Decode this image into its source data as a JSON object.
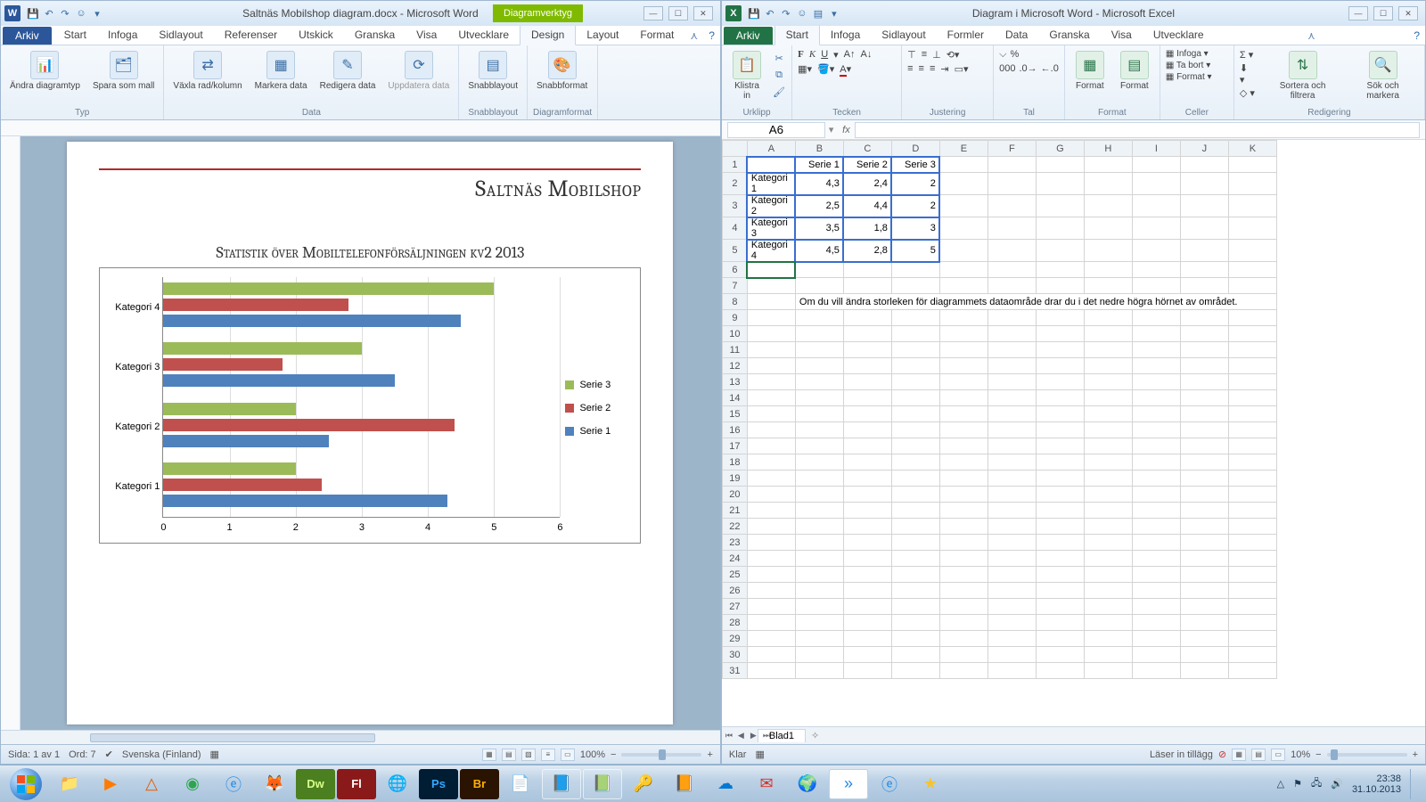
{
  "word": {
    "titlebar": "Saltnäs Mobilshop diagram.docx - Microsoft Word",
    "context_tab": "Diagramverktyg",
    "tabs": {
      "file": "Arkiv",
      "start": "Start",
      "infoga": "Infoga",
      "sidlayout": "Sidlayout",
      "referenser": "Referenser",
      "utskick": "Utskick",
      "granska": "Granska",
      "visa": "Visa",
      "utvecklare": "Utvecklare",
      "design": "Design",
      "layout": "Layout",
      "format": "Format"
    },
    "groups": {
      "typ": {
        "label": "Typ",
        "btn1": "Ändra\ndiagramtyp",
        "btn2": "Spara\nsom mall"
      },
      "data": {
        "label": "Data",
        "btn1": "Växla\nrad/kolumn",
        "btn2": "Markera\ndata",
        "btn3": "Redigera\ndata",
        "btn4": "Uppdatera\ndata"
      },
      "snabb": {
        "label": "Snabblayout",
        "btn1": "Snabblayout"
      },
      "format": {
        "label": "Diagramformat",
        "btn1": "Snabbformat"
      }
    },
    "doc": {
      "title": "Saltnäs Mobilshop",
      "chart_title": "Statistik över Mobiltelefonförsäljningen kv2 2013"
    },
    "status": {
      "page": "Sida: 1 av 1",
      "words": "Ord: 7",
      "lang": "Svenska (Finland)",
      "zoom": "100%"
    }
  },
  "excel": {
    "titlebar": "Diagram i Microsoft Word - Microsoft Excel",
    "tabs": {
      "file": "Arkiv",
      "start": "Start",
      "infoga": "Infoga",
      "sidlayout": "Sidlayout",
      "formler": "Formler",
      "data": "Data",
      "granska": "Granska",
      "visa": "Visa",
      "utvecklare": "Utvecklare"
    },
    "groups": {
      "urklipp": {
        "label": "Urklipp",
        "btn": "Klistra\nin"
      },
      "tecken": {
        "label": "Tecken"
      },
      "justering": {
        "label": "Justering"
      },
      "tal": {
        "label": "Tal"
      },
      "format": {
        "label": "Format",
        "btn1": "Format",
        "btn2": "Format"
      },
      "celler": {
        "label": "Celler",
        "insert": "Infoga",
        "delete": "Ta bort",
        "fmt": "Format"
      },
      "redigering": {
        "label": "Redigering",
        "sort": "Sortera och\nfiltrera",
        "find": "Sök och\nmarkera"
      }
    },
    "namebox": "A6",
    "headers": {
      "s1": "Serie 1",
      "s2": "Serie 2",
      "s3": "Serie 3"
    },
    "rows": {
      "k1": {
        "label": "Kategori 1",
        "v1": "4,3",
        "v2": "2,4",
        "v3": "2"
      },
      "k2": {
        "label": "Kategori 2",
        "v1": "2,5",
        "v2": "4,4",
        "v3": "2"
      },
      "k3": {
        "label": "Kategori 3",
        "v1": "3,5",
        "v2": "1,8",
        "v3": "3"
      },
      "k4": {
        "label": "Kategori 4",
        "v1": "4,5",
        "v2": "2,8",
        "v3": "5"
      }
    },
    "msg": "Om du vill ändra storleken för diagrammets dataområde drar du i det nedre högra hörnet av området.",
    "sheet_tab": "Blad1",
    "status": {
      "ready": "Klar",
      "loading": "Läser in tillägg",
      "zoom": "10%"
    }
  },
  "chart_data": {
    "type": "bar",
    "orientation": "horizontal",
    "title": "Statistik över Mobiltelefonförsäljningen kv2 2013",
    "categories": [
      "Kategori 1",
      "Kategori 2",
      "Kategori 3",
      "Kategori 4"
    ],
    "series": [
      {
        "name": "Serie 1",
        "color": "#4f81bd",
        "values": [
          4.3,
          2.5,
          3.5,
          4.5
        ]
      },
      {
        "name": "Serie 2",
        "color": "#c0504d",
        "values": [
          2.4,
          4.4,
          1.8,
          2.8
        ]
      },
      {
        "name": "Serie 3",
        "color": "#9bbb59",
        "values": [
          2,
          2,
          3,
          5
        ]
      }
    ],
    "xlim": [
      0,
      6
    ],
    "xticks": [
      0,
      1,
      2,
      3,
      4,
      5,
      6
    ],
    "legend_position": "right"
  },
  "legend": {
    "s1": "Serie 1",
    "s2": "Serie 2",
    "s3": "Serie 3"
  },
  "taskbar": {
    "time": "23:38",
    "date": "31.10.2013"
  }
}
